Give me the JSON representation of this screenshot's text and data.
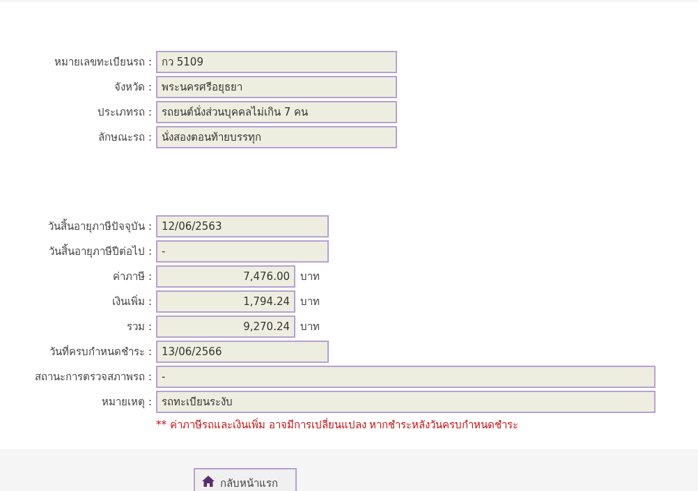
{
  "vehicle": [
    {
      "label": "หมายเลขทะเบียนรถ :",
      "value": "กว 5109",
      "kind": "medium"
    },
    {
      "label": "จังหวัด :",
      "value": "พระนครศรีอยุธยา",
      "kind": "medium"
    },
    {
      "label": "ประเภทรถ :",
      "value": "รถยนต์นั่งส่วนบุคคลไม่เกิน 7 คน",
      "kind": "medium"
    },
    {
      "label": "ลักษณะรถ :",
      "value": "นั่งสองตอนท้ายบรรทุก",
      "kind": "medium"
    }
  ],
  "tax": [
    {
      "label": "วันสิ้นอายุภาษีปัจจุบัน :",
      "value": "12/06/2563",
      "kind": "short"
    },
    {
      "label": "วันสิ้นอายุภาษีปีต่อไป :",
      "value": "-",
      "kind": "short"
    },
    {
      "label": "ค่าภาษี :",
      "value": "7,476.00",
      "kind": "money",
      "unit": "บาท"
    },
    {
      "label": "เงินเพิ่ม :",
      "value": "1,794.24",
      "kind": "money",
      "unit": "บาท"
    },
    {
      "label": "รวม :",
      "value": "9,270.24",
      "kind": "money",
      "unit": "บาท"
    },
    {
      "label": "วันที่ครบกำหนดชำระ :",
      "value": "13/06/2566",
      "kind": "short"
    },
    {
      "label": "สถานะการตรวจสภาพรถ :",
      "value": "-",
      "kind": "wide"
    },
    {
      "label": "หมายเหตุ :",
      "value": "รถทะเบียนระงับ",
      "kind": "wide"
    }
  ],
  "note": "** ค่าภาษีรถและเงินเพิ่ม อาจมีการเปลี่ยนแปลง หากชำระหลังวันครบกำหนดชำระ",
  "back_button": "กลับหน้าแรก"
}
